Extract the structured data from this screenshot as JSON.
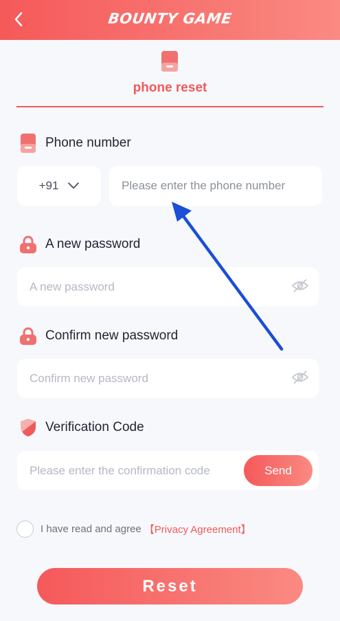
{
  "header": {
    "logo_text": "BOUNTY GAME",
    "back_icon": "chevron-left-icon"
  },
  "tab": {
    "label": "phone reset",
    "icon": "phone-icon"
  },
  "phone_section": {
    "label": "Phone number",
    "country_code": "+91",
    "placeholder": "Please enter the phone number"
  },
  "new_password": {
    "label": "A new password",
    "placeholder": "A new password"
  },
  "confirm_password": {
    "label": "Confirm new password",
    "placeholder": "Confirm new password"
  },
  "verification": {
    "label": "Verification Code",
    "placeholder": "Please enter the confirmation code",
    "send_label": "Send"
  },
  "agreement": {
    "text": "I have read and agree",
    "link": "【Privacy Agreement】"
  },
  "reset_label": "Reset",
  "colors": {
    "accent": "#ef5a5a",
    "gradient_start": "#f5595a",
    "gradient_end": "#fa8a82",
    "annotation_arrow": "#1a4fd6"
  }
}
